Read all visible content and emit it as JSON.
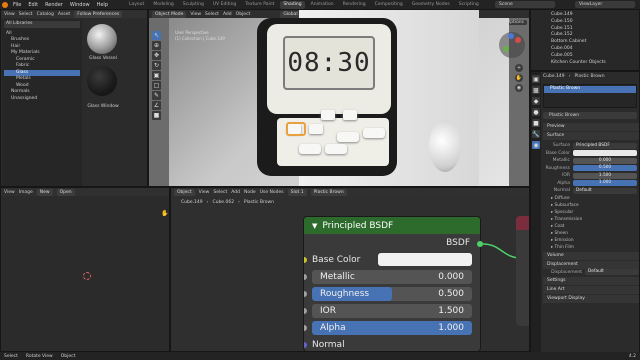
{
  "topbar": {
    "menus": [
      "File",
      "Edit",
      "Render",
      "Window",
      "Help"
    ],
    "workspaces": [
      "Layout",
      "Modeling",
      "Sculpting",
      "UV Editing",
      "Texture Paint",
      "Shading",
      "Animation",
      "Rendering",
      "Compositing",
      "Geometry Nodes",
      "Scripting"
    ],
    "active_workspace": "Shading",
    "scene": "Scene",
    "view_layer": "ViewLayer"
  },
  "file_browser": {
    "header": [
      "View",
      "Select",
      "Catalog",
      "Asset"
    ],
    "prefs_label": "Follow Preferences",
    "all_libraries": "All Libraries",
    "tree": [
      {
        "label": "All",
        "indent": 0
      },
      {
        "label": "Brushes",
        "indent": 1
      },
      {
        "label": "Hair",
        "indent": 1
      },
      {
        "label": "My Materials",
        "indent": 1
      },
      {
        "label": "Ceramic",
        "indent": 2
      },
      {
        "label": "Fabric",
        "indent": 2
      },
      {
        "label": "Glass",
        "indent": 2,
        "selected": true
      },
      {
        "label": "Metals",
        "indent": 2
      },
      {
        "label": "Wood",
        "indent": 2
      },
      {
        "label": "Normals",
        "indent": 1
      },
      {
        "label": "Unassigned",
        "indent": 1
      }
    ],
    "assets": [
      {
        "label": "Glass Vessel"
      },
      {
        "label": "Glass Window"
      }
    ]
  },
  "viewport": {
    "mode": "Object Mode",
    "header": [
      "View",
      "Select",
      "Add",
      "Object"
    ],
    "orientation": "Global",
    "options_label": "Options",
    "clock_text": "08:30",
    "overlay_text": [
      "User Perspective",
      "(1) Collection | Cube.149"
    ]
  },
  "outliner": {
    "items": [
      {
        "label": "Cube.149"
      },
      {
        "label": "Cube.150"
      },
      {
        "label": "Cube.151"
      },
      {
        "label": "Cube.152"
      },
      {
        "label": "Bottom Cabinet"
      },
      {
        "label": "Cube.004"
      },
      {
        "label": "Cube.005"
      },
      {
        "label": "Kitchen Counter Objects"
      }
    ]
  },
  "properties": {
    "object": "Cube.149",
    "material": "Plastic Brown",
    "slot_material": "Plastic Brown",
    "sections": {
      "preview": "Preview",
      "surface": "Surface",
      "volume": "Volume",
      "displacement": "Displacement",
      "settings": "Settings",
      "line_art": "Line Art",
      "viewport_display": "Viewport Display"
    },
    "surface_shader": "Principled BSDF",
    "rows": [
      {
        "label": "Surface",
        "value": "Principled BSDF",
        "style": "plain"
      },
      {
        "label": "Base Color",
        "value": "",
        "style": "white"
      },
      {
        "label": "Metallic",
        "value": "0.000",
        "style": "gray"
      },
      {
        "label": "Roughness",
        "value": "0.500",
        "style": "blue"
      },
      {
        "label": "IOR",
        "value": "1.500",
        "style": "gray"
      },
      {
        "label": "Alpha",
        "value": "1.000",
        "style": "blue"
      },
      {
        "label": "Normal",
        "value": "Default",
        "style": "plain"
      }
    ],
    "subsections": [
      "Diffuse",
      "Subsurface",
      "Specular",
      "Transmission",
      "Coat",
      "Sheen",
      "Emission",
      "Thin Film"
    ],
    "displacement_label": "Displacement",
    "displacement_value": "Default"
  },
  "image_editor": {
    "header": [
      "View",
      "Image"
    ],
    "new_label": "New",
    "open_label": "Open"
  },
  "node_editor": {
    "header": [
      "Object",
      "View",
      "Select",
      "Add",
      "Node"
    ],
    "use_nodes": "Use Nodes",
    "slot": "Slot 1",
    "material": "Plastic Brown",
    "breadcrumb": [
      "Cube.149",
      "Cube.062",
      "Plastic Brown"
    ],
    "node": {
      "title": "Principled BSDF",
      "output": "BSDF",
      "inputs": [
        {
          "label": "Base Color",
          "kind": "color",
          "socket": "#c7c729"
        },
        {
          "label": "Metallic",
          "value": "0.000",
          "fill": 0,
          "socket": "#a1a1a1"
        },
        {
          "label": "Roughness",
          "value": "0.500",
          "fill": 0.5,
          "socket": "#a1a1a1"
        },
        {
          "label": "IOR",
          "value": "1.500",
          "fill": 0,
          "socket": "#a1a1a1"
        },
        {
          "label": "Alpha",
          "value": "1.000",
          "fill": 1,
          "socket": "#a1a1a1"
        },
        {
          "label": "Normal",
          "kind": "socket",
          "socket": "#6363c7"
        }
      ]
    }
  },
  "statusbar": {
    "items": [
      "Select",
      "Rotate View",
      "Object"
    ],
    "version": "4.2"
  }
}
